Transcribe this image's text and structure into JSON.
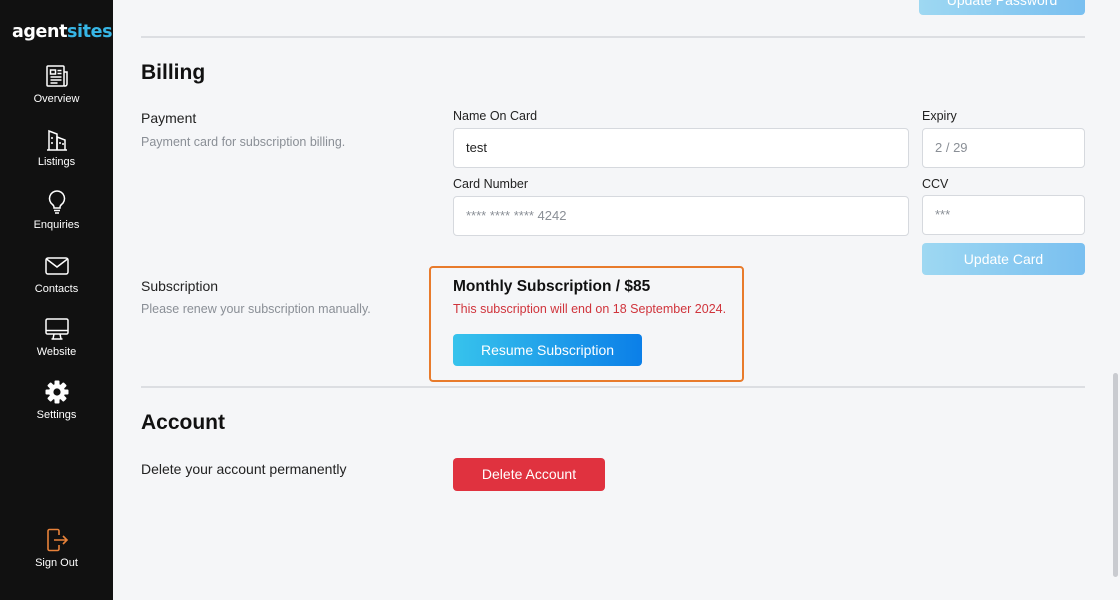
{
  "brand": {
    "part1": "agent",
    "part2": "sites"
  },
  "sidebar": {
    "items": [
      {
        "label": "Overview",
        "icon": "newspaper-icon"
      },
      {
        "label": "Listings",
        "icon": "building-icon"
      },
      {
        "label": "Enquiries",
        "icon": "lightbulb-icon"
      },
      {
        "label": "Contacts",
        "icon": "envelope-icon"
      },
      {
        "label": "Website",
        "icon": "monitor-icon"
      },
      {
        "label": "Settings",
        "icon": "gear-icon",
        "active": true
      }
    ],
    "sign_out": {
      "label": "Sign Out",
      "icon": "sign-out-icon",
      "icon_color": "#e8823a"
    }
  },
  "top": {
    "update_password_label": "Update Password"
  },
  "billing": {
    "title": "Billing",
    "payment": {
      "title": "Payment",
      "description": "Payment card for subscription billing.",
      "name_on_card": {
        "label": "Name On Card",
        "value": "test"
      },
      "expiry": {
        "label": "Expiry",
        "placeholder": "2 / 29"
      },
      "card_number": {
        "label": "Card Number",
        "placeholder": "**** **** **** 4242"
      },
      "ccv": {
        "label": "CCV",
        "placeholder": "***"
      },
      "update_card_label": "Update Card"
    },
    "subscription": {
      "title": "Subscription",
      "description": "Please renew your subscription manually.",
      "plan": "Monthly Subscription / $85",
      "notice": "This subscription will end on 18 September 2024.",
      "resume_label": "Resume Subscription",
      "highlight_color": "#e87b2c"
    }
  },
  "account": {
    "title": "Account",
    "delete_text": "Delete your account permanently",
    "delete_label": "Delete Account",
    "delete_color": "#e0323f"
  }
}
